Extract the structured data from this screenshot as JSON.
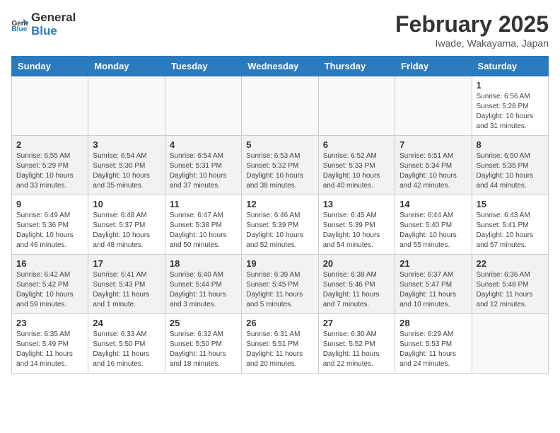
{
  "header": {
    "logo_general": "General",
    "logo_blue": "Blue",
    "month_title": "February 2025",
    "location": "Iwade, Wakayama, Japan"
  },
  "days_of_week": [
    "Sunday",
    "Monday",
    "Tuesday",
    "Wednesday",
    "Thursday",
    "Friday",
    "Saturday"
  ],
  "weeks": [
    [
      {
        "day": "",
        "info": ""
      },
      {
        "day": "",
        "info": ""
      },
      {
        "day": "",
        "info": ""
      },
      {
        "day": "",
        "info": ""
      },
      {
        "day": "",
        "info": ""
      },
      {
        "day": "",
        "info": ""
      },
      {
        "day": "1",
        "info": "Sunrise: 6:56 AM\nSunset: 5:28 PM\nDaylight: 10 hours and 31 minutes."
      }
    ],
    [
      {
        "day": "2",
        "info": "Sunrise: 6:55 AM\nSunset: 5:29 PM\nDaylight: 10 hours and 33 minutes."
      },
      {
        "day": "3",
        "info": "Sunrise: 6:54 AM\nSunset: 5:30 PM\nDaylight: 10 hours and 35 minutes."
      },
      {
        "day": "4",
        "info": "Sunrise: 6:54 AM\nSunset: 5:31 PM\nDaylight: 10 hours and 37 minutes."
      },
      {
        "day": "5",
        "info": "Sunrise: 6:53 AM\nSunset: 5:32 PM\nDaylight: 10 hours and 38 minutes."
      },
      {
        "day": "6",
        "info": "Sunrise: 6:52 AM\nSunset: 5:33 PM\nDaylight: 10 hours and 40 minutes."
      },
      {
        "day": "7",
        "info": "Sunrise: 6:51 AM\nSunset: 5:34 PM\nDaylight: 10 hours and 42 minutes."
      },
      {
        "day": "8",
        "info": "Sunrise: 6:50 AM\nSunset: 5:35 PM\nDaylight: 10 hours and 44 minutes."
      }
    ],
    [
      {
        "day": "9",
        "info": "Sunrise: 6:49 AM\nSunset: 5:36 PM\nDaylight: 10 hours and 46 minutes."
      },
      {
        "day": "10",
        "info": "Sunrise: 6:48 AM\nSunset: 5:37 PM\nDaylight: 10 hours and 48 minutes."
      },
      {
        "day": "11",
        "info": "Sunrise: 6:47 AM\nSunset: 5:38 PM\nDaylight: 10 hours and 50 minutes."
      },
      {
        "day": "12",
        "info": "Sunrise: 6:46 AM\nSunset: 5:39 PM\nDaylight: 10 hours and 52 minutes."
      },
      {
        "day": "13",
        "info": "Sunrise: 6:45 AM\nSunset: 5:39 PM\nDaylight: 10 hours and 54 minutes."
      },
      {
        "day": "14",
        "info": "Sunrise: 6:44 AM\nSunset: 5:40 PM\nDaylight: 10 hours and 55 minutes."
      },
      {
        "day": "15",
        "info": "Sunrise: 6:43 AM\nSunset: 5:41 PM\nDaylight: 10 hours and 57 minutes."
      }
    ],
    [
      {
        "day": "16",
        "info": "Sunrise: 6:42 AM\nSunset: 5:42 PM\nDaylight: 10 hours and 59 minutes."
      },
      {
        "day": "17",
        "info": "Sunrise: 6:41 AM\nSunset: 5:43 PM\nDaylight: 11 hours and 1 minute."
      },
      {
        "day": "18",
        "info": "Sunrise: 6:40 AM\nSunset: 5:44 PM\nDaylight: 11 hours and 3 minutes."
      },
      {
        "day": "19",
        "info": "Sunrise: 6:39 AM\nSunset: 5:45 PM\nDaylight: 11 hours and 5 minutes."
      },
      {
        "day": "20",
        "info": "Sunrise: 6:38 AM\nSunset: 5:46 PM\nDaylight: 11 hours and 7 minutes."
      },
      {
        "day": "21",
        "info": "Sunrise: 6:37 AM\nSunset: 5:47 PM\nDaylight: 11 hours and 10 minutes."
      },
      {
        "day": "22",
        "info": "Sunrise: 6:36 AM\nSunset: 5:48 PM\nDaylight: 11 hours and 12 minutes."
      }
    ],
    [
      {
        "day": "23",
        "info": "Sunrise: 6:35 AM\nSunset: 5:49 PM\nDaylight: 11 hours and 14 minutes."
      },
      {
        "day": "24",
        "info": "Sunrise: 6:33 AM\nSunset: 5:50 PM\nDaylight: 11 hours and 16 minutes."
      },
      {
        "day": "25",
        "info": "Sunrise: 6:32 AM\nSunset: 5:50 PM\nDaylight: 11 hours and 18 minutes."
      },
      {
        "day": "26",
        "info": "Sunrise: 6:31 AM\nSunset: 5:51 PM\nDaylight: 11 hours and 20 minutes."
      },
      {
        "day": "27",
        "info": "Sunrise: 6:30 AM\nSunset: 5:52 PM\nDaylight: 11 hours and 22 minutes."
      },
      {
        "day": "28",
        "info": "Sunrise: 6:29 AM\nSunset: 5:53 PM\nDaylight: 11 hours and 24 minutes."
      },
      {
        "day": "",
        "info": ""
      }
    ]
  ]
}
